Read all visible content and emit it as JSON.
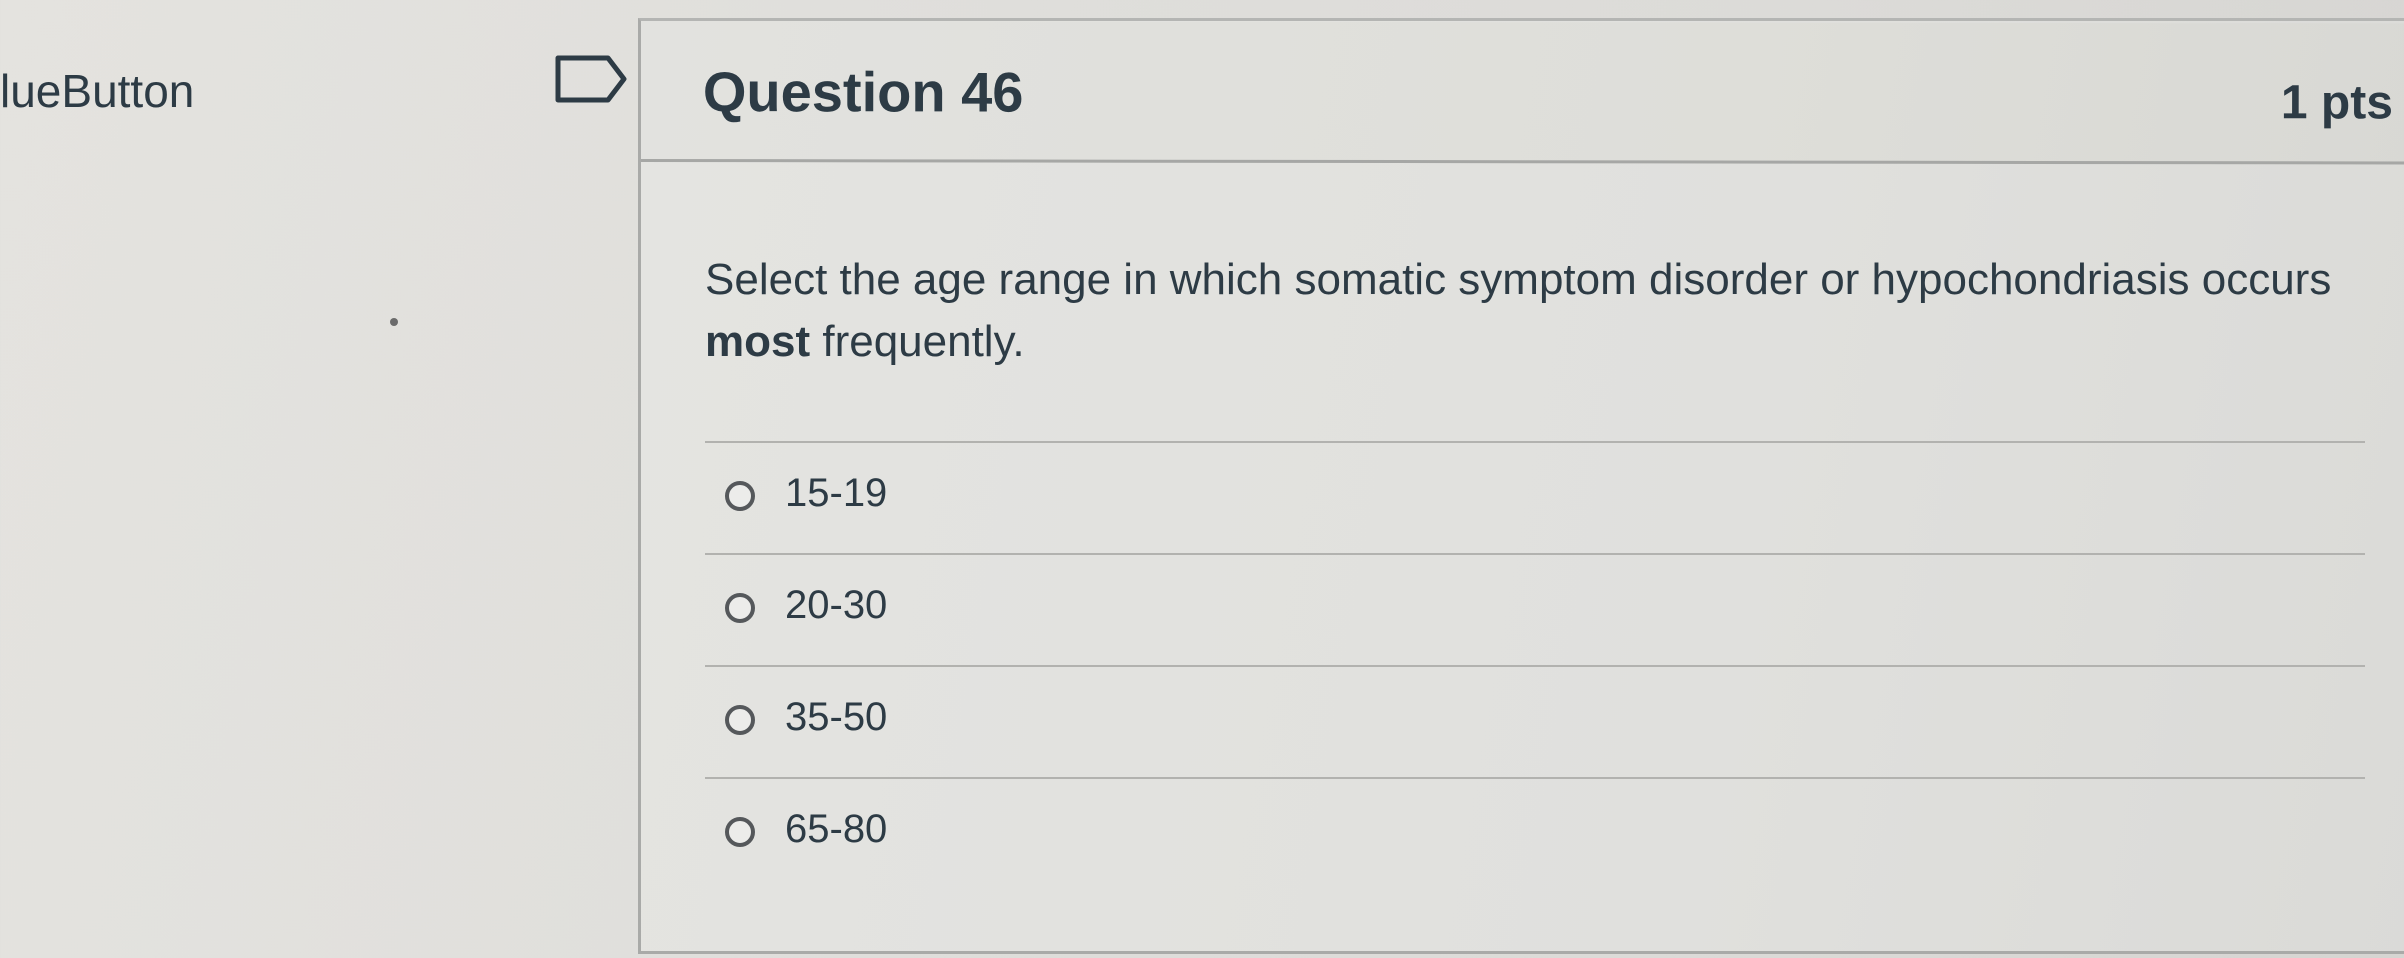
{
  "sidebar": {
    "label": "lueButton"
  },
  "icons": {
    "flag": "flag-icon",
    "radio": "radio-icon"
  },
  "question": {
    "title": "Question 46",
    "points": "1 pts",
    "text_part1": "Select the age range in which somatic symptom disorder or hypochondriasis occurs ",
    "text_bold": "most",
    "text_part2": " frequently.",
    "answers": [
      {
        "label": "15-19",
        "selected": false
      },
      {
        "label": "20-30",
        "selected": false
      },
      {
        "label": "35-50",
        "selected": false
      },
      {
        "label": "65-80",
        "selected": false
      }
    ]
  },
  "colors": {
    "text": "#2d3b45",
    "background": "#e0dfdc",
    "border": "#a9aaa8"
  }
}
